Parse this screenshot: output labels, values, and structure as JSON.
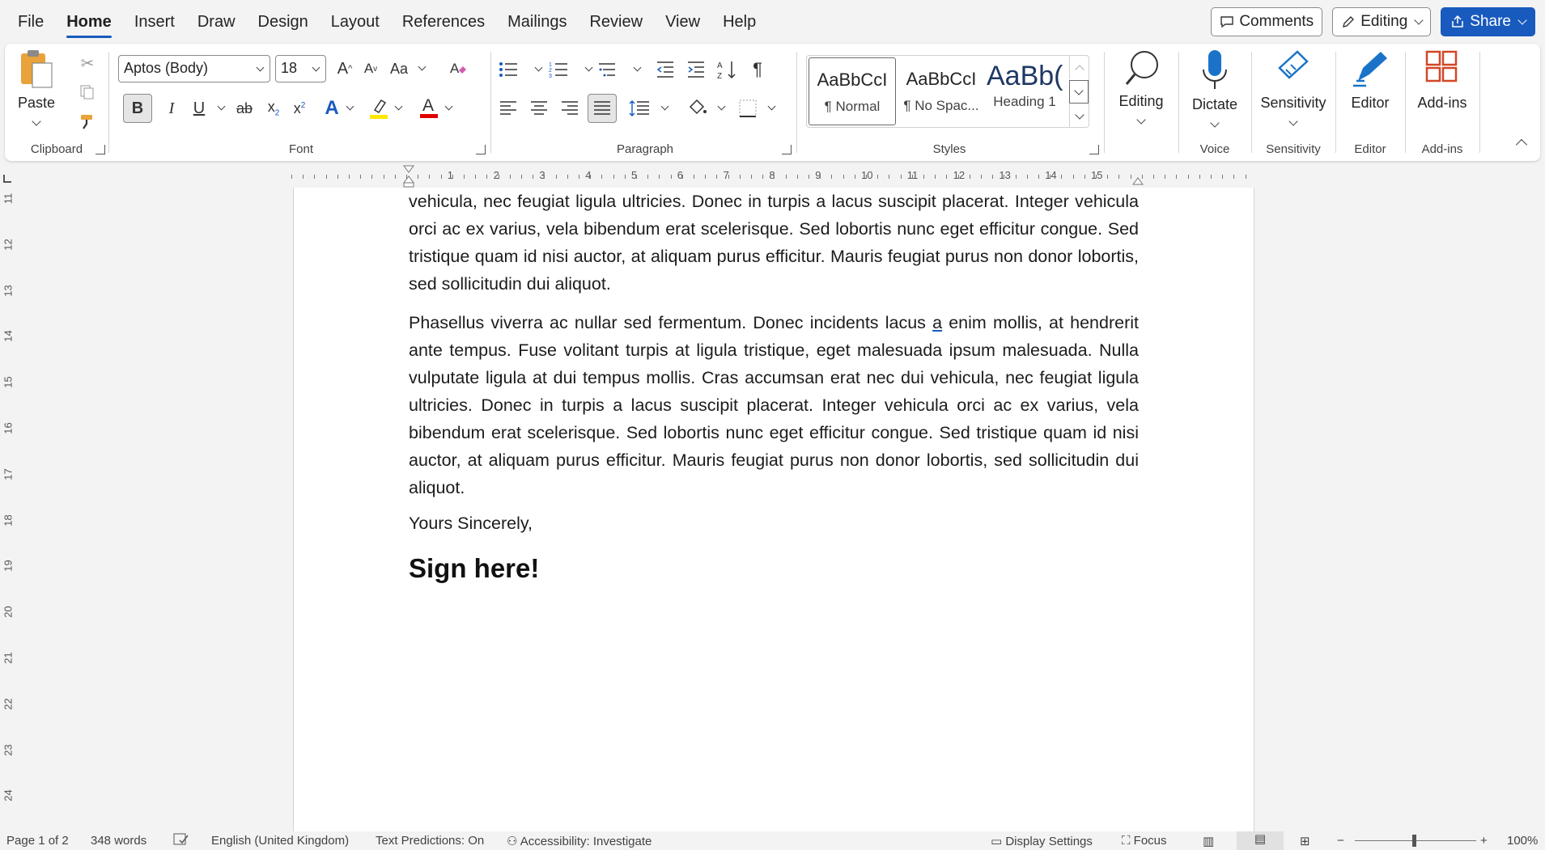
{
  "menu": {
    "tabs": [
      "File",
      "Home",
      "Insert",
      "Draw",
      "Design",
      "Layout",
      "References",
      "Mailings",
      "Review",
      "View",
      "Help"
    ],
    "active": "Home",
    "comments": "Comments",
    "editing": "Editing",
    "share": "Share"
  },
  "ribbon": {
    "clipboard": {
      "paste": "Paste",
      "label": "Clipboard"
    },
    "font": {
      "name": "Aptos (Body)",
      "size": "18",
      "label": "Font",
      "bold": "B",
      "italic": "I",
      "underline": "U",
      "strike": "ab",
      "grow": "A",
      "shrink": "A",
      "case": "Aa"
    },
    "paragraph": {
      "label": "Paragraph"
    },
    "styles": {
      "label": "Styles",
      "items": [
        {
          "preview": "AaBbCcI",
          "name": "¶ Normal"
        },
        {
          "preview": "AaBbCcI",
          "name": "¶ No Spac..."
        },
        {
          "preview": "AaBb(",
          "name": "Heading 1"
        }
      ]
    },
    "editing": {
      "btn": "Editing"
    },
    "voice": {
      "btn": "Dictate",
      "label": "Voice"
    },
    "sensitivity": {
      "btn": "Sensitivity",
      "label": "Sensitivity"
    },
    "editor": {
      "btn": "Editor",
      "label": "Editor"
    },
    "addins": {
      "btn": "Add-ins",
      "label": "Add-ins"
    },
    "colors": {
      "highlight": "#ffe600",
      "font_color": "#e00000",
      "accent": "#185abd",
      "styles_accent": "#2b579a"
    }
  },
  "ruler": {
    "h": [
      "1",
      "2",
      "3",
      "4",
      "5",
      "6",
      "7",
      "8",
      "9",
      "10",
      "11",
      "12",
      "13",
      "14",
      "15"
    ],
    "v": [
      "11",
      "12",
      "13",
      "14",
      "15",
      "16",
      "17",
      "18",
      "19",
      "20",
      "21",
      "22",
      "23",
      "24"
    ]
  },
  "doc": {
    "para1": "vehicula, nec feugiat ligula ultricies. Donec in turpis a lacus suscipit placerat. Integer vehicula orci ac ex varius, vela bibendum erat scelerisque. Sed lobortis nunc eget efficitur congue. Sed tristique quam id nisi auctor, at aliquam purus efficitur. Mauris feugiat purus non donor lobortis, sed sollicitudin dui aliquot.",
    "para2a": "Phasellus viverra ac nullar sed fermentum. Donec incidents lacus ",
    "para2u": "a",
    "para2b": " enim mollis, at hendrerit ante tempus. Fuse volitant turpis at ligula tristique, eget malesuada ipsum malesuada. Nulla vulputate ligula at dui tempus mollis. Cras accumsan erat nec dui vehicula, nec feugiat ligula ultricies. Donec in turpis a lacus suscipit placerat. Integer vehicula orci ac ex varius, vela bibendum erat scelerisque. Sed lobortis nunc eget efficitur congue. Sed tristique quam id nisi auctor, at aliquam purus efficitur. Mauris feugiat purus non donor lobortis, sed sollicitudin dui aliquot.",
    "closing": "Yours Sincerely,",
    "sign": "Sign here!"
  },
  "status": {
    "page": "Page 1 of 2",
    "words": "348 words",
    "language": "English (United Kingdom)",
    "predictions": "Text Predictions: On",
    "accessibility": "Accessibility: Investigate",
    "display": "Display Settings",
    "focus": "Focus",
    "zoom": "100%"
  }
}
